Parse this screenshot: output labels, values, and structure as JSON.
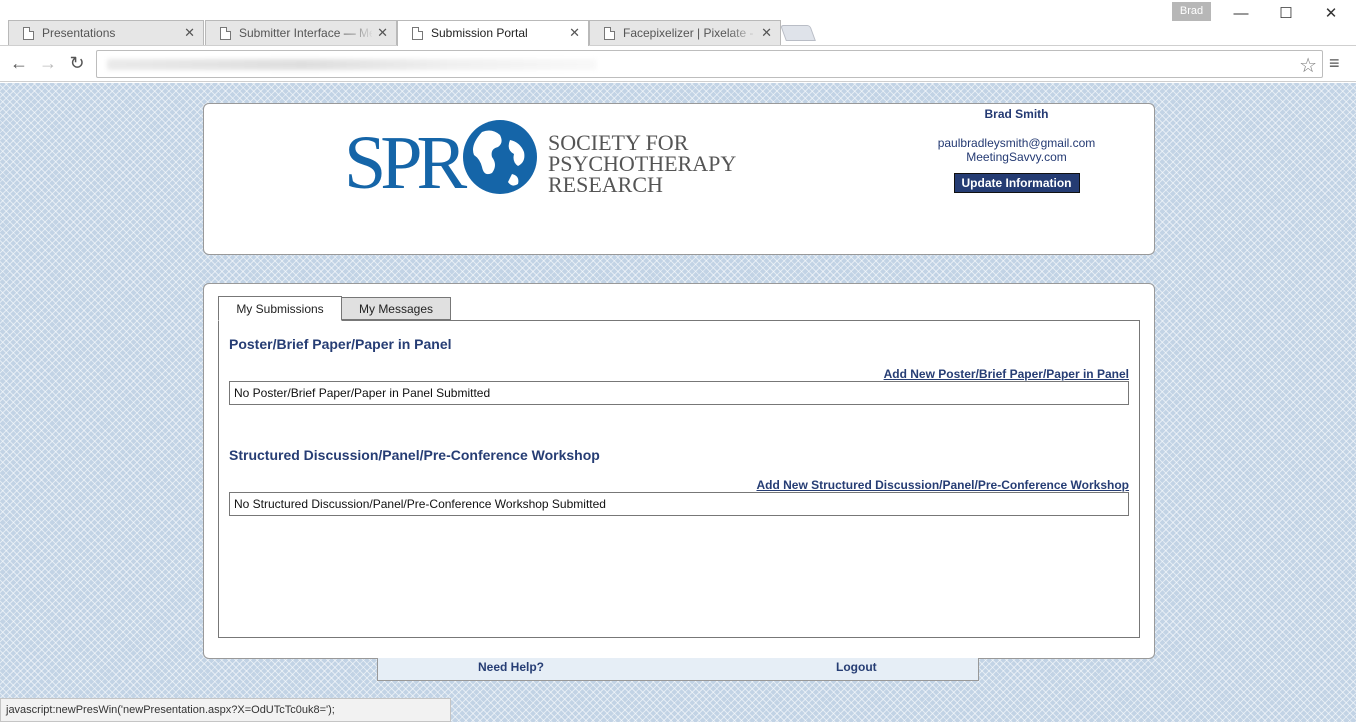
{
  "browser": {
    "tabs": [
      {
        "label": "Presentations",
        "active": false
      },
      {
        "label": "Submitter Interface — Me",
        "active": false
      },
      {
        "label": "Submission Portal",
        "active": true
      },
      {
        "label": "Facepixelizer | Pixelate - Bl",
        "active": false
      }
    ],
    "profile_name": "Brad",
    "status_text": "javascript:newPresWin('newPresentation.aspx?X=OdUTcTc0uk8=');"
  },
  "header": {
    "logo": {
      "mark": "SPR",
      "line1": "SOCIETY FOR",
      "line2": "PSYCHOTHERAPY",
      "line3": "RESEARCH"
    },
    "user_name": "Brad Smith",
    "user_email": "paulbradleysmith@gmail.com",
    "user_company": "MeetingSavvy.com",
    "update_button": "Update Information"
  },
  "main": {
    "tabs": [
      {
        "label": "My Submissions",
        "active": true
      },
      {
        "label": "My Messages",
        "active": false
      }
    ],
    "sections": [
      {
        "title": "Poster/Brief Paper/Paper in Panel",
        "add_link": "Add New Poster/Brief Paper/Paper in Panel",
        "empty_text": "No Poster/Brief Paper/Paper in Panel Submitted"
      },
      {
        "title": "Structured Discussion/Panel/Pre-Conference Workshop",
        "add_link": "Add New Structured Discussion/Panel/Pre-Conference Workshop",
        "empty_text": "No Structured Discussion/Panel/Pre-Conference Workshop Submitted"
      }
    ]
  },
  "footer": {
    "help_link": "Need Help?",
    "logout_link": "Logout"
  },
  "colors": {
    "brand_navy": "#253c73",
    "logo_blue": "#1565a8",
    "page_bg": "#c2d3e5"
  }
}
